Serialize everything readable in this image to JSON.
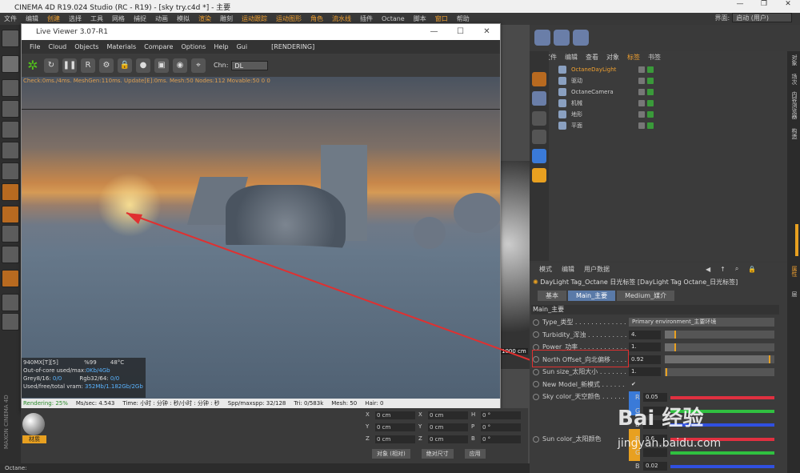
{
  "app": {
    "title": "CINEMA 4D R19.024 Studio (RC - R19) - [sky try.c4d *] - 主要",
    "window_controls": [
      "—",
      "❐",
      "✕"
    ]
  },
  "menubar": {
    "items": [
      "文件",
      "编辑",
      "创建",
      "选择",
      "工具",
      "网格",
      "捕捉",
      "动画",
      "模拟",
      "渲染",
      "雕刻",
      "运动跟踪",
      "运动图形",
      "角色",
      "流水线",
      "插件",
      "Octane",
      "脚本",
      "窗口",
      "帮助"
    ],
    "interface_label": "界面:",
    "interface_value": "启动 (用户)"
  },
  "live_viewer": {
    "title": "Live Viewer 3.07-R1",
    "window_controls": [
      "—",
      "☐",
      "✕"
    ],
    "menu": [
      "File",
      "Cloud",
      "Objects",
      "Materials",
      "Compare",
      "Options",
      "Help",
      "Gui",
      "[RENDERING]"
    ],
    "chn_label": "Chn:",
    "chn_value": "DL",
    "check_text": "Check:0ms./4ms. MeshGen:110ms. Update[E]:0ms. Mesh:50 Nodes:112 Movable:50  0 0",
    "stats": {
      "gpu": "940MX[T][5]",
      "pct": "%99",
      "temp": "48°C",
      "outofcore": "Out-of-core used/max:",
      "outofcore_val": "0Kb/4Gb",
      "grey": "Grey8/16: ",
      "grey_val": "0/0",
      "rgb": "Rgb32/64: ",
      "rgb_val": "0/0",
      "vram": "Used/free/total vram: ",
      "vram_val": "352Mb/1.182Gb/2Gb"
    },
    "status": {
      "rendering": "Rendering: 25%",
      "mssec": "Ms/sec: 4.543",
      "time": "Time: 小时 : 分钟 : 秒/小时 : 分钟 : 秒",
      "spp": "Spp/maxspp: 32/128",
      "tri": "Tri: 0/583k",
      "mesh": "Mesh: 50",
      "hair": "Hair: 0"
    },
    "progress": 0.25
  },
  "object_manager": {
    "menu": [
      "文件",
      "编辑",
      "查看",
      "对象",
      "标签",
      "书签"
    ],
    "objects": [
      {
        "name": "OctaneDayLight",
        "active": true
      },
      {
        "name": "驱动",
        "active": false
      },
      {
        "name": "OctaneCamera",
        "active": false
      },
      {
        "name": "机械",
        "active": false
      },
      {
        "name": "地形",
        "active": false
      },
      {
        "name": "平面",
        "active": false
      }
    ]
  },
  "attribute_manager": {
    "menu": [
      "模式",
      "编辑",
      "用户数据"
    ],
    "title": "DayLight Tag_Octane 日光标签 [DayLight Tag Octane_日光标签]",
    "tabs": [
      "基本",
      "Main_主要",
      "Medium_媒介"
    ],
    "active_tab": 1,
    "section": "Main_主要",
    "params": [
      {
        "label": "Type_类型 . . . . . . . . . . . . . .",
        "value": "Primary environment_主要环境",
        "kind": "select"
      },
      {
        "label": "Turbidity_浑浊 . . . . . . . . . . .",
        "value": "4.",
        "kind": "slider",
        "fill": 0.1
      },
      {
        "label": "Power_功率 . . . . . . . . . . . . . .",
        "value": "1.",
        "kind": "slider",
        "fill": 0.1
      },
      {
        "label": "North Offset_向北偏移 . . . . . . .",
        "value": "0.92",
        "kind": "slider",
        "fill": 0.96
      },
      {
        "label": "Sun size_太阳大小 . . . . . . . . .",
        "value": "1.",
        "kind": "slider",
        "fill": 0.02
      },
      {
        "label": "New Model_新模式 . . . . . . . . . .",
        "value": "✔",
        "kind": "check"
      },
      {
        "label": "Sky color_天空颜色 . . . . . . . . .",
        "value": "",
        "kind": "color"
      }
    ],
    "sky_rgb": [
      {
        "ch": "R",
        "v": "0.05"
      },
      {
        "ch": "G",
        "v": ""
      },
      {
        "ch": "B",
        "v": ""
      }
    ],
    "sun_color_label": "Sun color_太阳颜色",
    "sun_rgb": [
      {
        "ch": "R",
        "v": "0.6"
      },
      {
        "ch": "G",
        "v": ""
      },
      {
        "ch": "B",
        "v": "0.02"
      }
    ]
  },
  "coordinates": {
    "rows": [
      {
        "a": "X",
        "av": "0 cm",
        "b": "X",
        "bv": "0 cm",
        "c": "H",
        "cv": "0 °"
      },
      {
        "a": "Y",
        "av": "0 cm",
        "b": "Y",
        "bv": "0 cm",
        "c": "P",
        "cv": "0 °"
      },
      {
        "a": "Z",
        "av": "0 cm",
        "b": "Z",
        "bv": "0 cm",
        "c": "B",
        "cv": "0 °"
      }
    ],
    "mode1": "对象 (相对)",
    "mode2": "绝对尺寸",
    "apply": "应用"
  },
  "viewport_readout": "1000 cm",
  "material": {
    "label": "材质"
  },
  "statusbar": {
    "text": "Octane:"
  },
  "branding": {
    "maxon": "MAXON CINEMA 4D"
  },
  "watermark": {
    "baidu": "Bai 经验",
    "url": "jingyan.baidu.com"
  },
  "right_tabs": [
    "对象",
    "场次",
    "内容浏览器",
    "构造",
    "属性",
    "层"
  ],
  "colors": {
    "accent": "#e8a020",
    "highlight_box": "#e03030",
    "arrow": "#e03030"
  }
}
